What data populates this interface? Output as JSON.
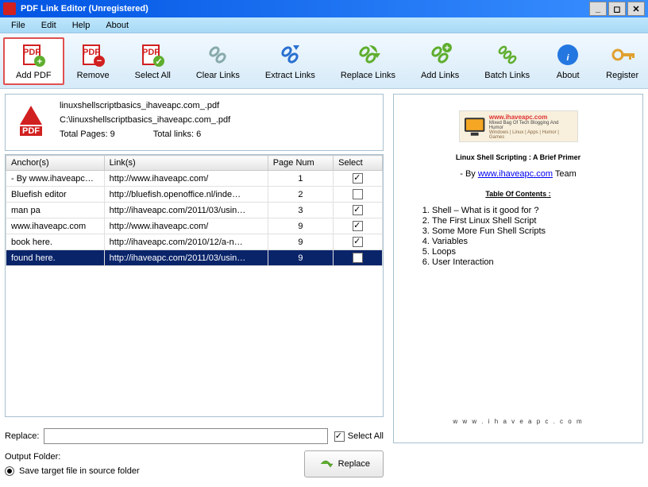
{
  "title": "PDF Link Editor (Unregistered)",
  "win_buttons": {
    "min": "_",
    "max": "◻",
    "close": "✕"
  },
  "menubar": [
    "File",
    "Edit",
    "Help",
    "About"
  ],
  "toolbar": [
    {
      "label": "Add PDF",
      "icon": "pdf-add",
      "highlight": true
    },
    {
      "label": "Remove",
      "icon": "pdf-remove"
    },
    {
      "label": "Select All",
      "icon": "pdf-select"
    },
    {
      "label": "Clear Links",
      "icon": "link-clear"
    },
    {
      "label": "Extract Links",
      "icon": "link-extract"
    },
    {
      "label": "Replace Links",
      "icon": "link-replace"
    },
    {
      "label": "Add Links",
      "icon": "link-add"
    },
    {
      "label": "Batch Links",
      "icon": "link-batch"
    },
    {
      "label": "About",
      "icon": "info"
    },
    {
      "label": "Register",
      "icon": "key"
    }
  ],
  "file": {
    "name": "linuxshellscriptbasics_ihaveapc.com_.pdf",
    "path": "C:\\linuxshellscriptbasics_ihaveapc.com_.pdf",
    "pages_label": "Total Pages: 9",
    "links_label": "Total links: 6"
  },
  "table": {
    "headers": {
      "anchor": "Anchor(s)",
      "link": "Link(s)",
      "page": "Page Num",
      "select": "Select"
    },
    "rows": [
      {
        "anchor": "- By www.ihaveapc…",
        "link": "http://www.ihaveapc.com/",
        "page": "1",
        "checked": true,
        "selected": false
      },
      {
        "anchor": "Bluefish   editor",
        "link": "http://bluefish.openoffice.nl/inde…",
        "page": "2",
        "checked": false,
        "selected": false
      },
      {
        "anchor": "man pa",
        "link": "http://ihaveapc.com/2011/03/usin…",
        "page": "3",
        "checked": true,
        "selected": false
      },
      {
        "anchor": "www.ihaveapc.com",
        "link": "http://www.ihaveapc.com/",
        "page": "9",
        "checked": true,
        "selected": false
      },
      {
        "anchor": "book here.",
        "link": "http://ihaveapc.com/2010/12/a-n…",
        "page": "9",
        "checked": true,
        "selected": false
      },
      {
        "anchor": "found here.",
        "link": "http://ihaveapc.com/2011/03/usin…",
        "page": "9",
        "checked": true,
        "selected": true
      }
    ]
  },
  "bottom": {
    "replace_label": "Replace:",
    "replace_value": "",
    "select_all_label": "Select All",
    "select_all_checked": true,
    "output_label": "Output Folder:",
    "replace_button": "Replace",
    "radio_label": "Save target file in source folder",
    "radio_checked": true
  },
  "preview": {
    "banner_domain": "www.ihaveapc.com",
    "banner_sub1": "Mixed Bag Of Tech Blogging And Humor",
    "banner_sub2": "Windows | Linux | Apps | Humor | Games",
    "title": "Linux Shell Scripting : A Brief Primer",
    "by_prefix": "- By ",
    "by_link": "www.ihaveapc.com",
    "by_suffix": " Team",
    "toc": "Table Of Contents :",
    "items": [
      "Shell – What is it good for ?",
      "The First Linux Shell Script",
      "Some More Fun Shell Scripts",
      "Variables",
      "Loops",
      "User Interaction"
    ],
    "footer": "w w w . i h a v e a p c . c o m"
  }
}
